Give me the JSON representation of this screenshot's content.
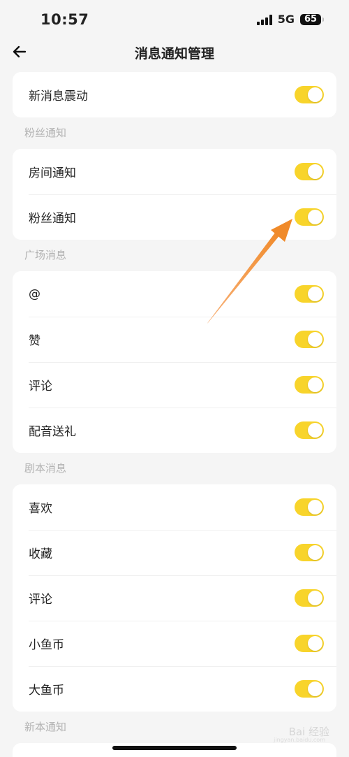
{
  "status_bar": {
    "time": "10:57",
    "network": "5G",
    "battery": "65"
  },
  "header": {
    "back_icon": "arrow-left-icon",
    "title": "消息通知管理"
  },
  "top_card": {
    "items": [
      {
        "label": "新消息震动",
        "enabled": true
      }
    ]
  },
  "sections": [
    {
      "title": "粉丝通知",
      "items": [
        {
          "label": "房间通知",
          "enabled": true
        },
        {
          "label": "粉丝通知",
          "enabled": true
        }
      ]
    },
    {
      "title": "广场消息",
      "items": [
        {
          "label": "@",
          "enabled": true
        },
        {
          "label": "赞",
          "enabled": true
        },
        {
          "label": "评论",
          "enabled": true
        },
        {
          "label": "配音送礼",
          "enabled": true
        }
      ]
    },
    {
      "title": "剧本消息",
      "items": [
        {
          "label": "喜欢",
          "enabled": true
        },
        {
          "label": "收藏",
          "enabled": true
        },
        {
          "label": "评论",
          "enabled": true
        },
        {
          "label": "小鱼币",
          "enabled": true
        },
        {
          "label": "大鱼币",
          "enabled": true
        }
      ]
    },
    {
      "title": "新本通知",
      "items": []
    }
  ],
  "colors": {
    "toggle_on": "#f8d42b",
    "annotation_arrow": "#f39a3c"
  },
  "watermark": {
    "text": "Bai 经验",
    "sub": "jingyan.baidu.com"
  }
}
